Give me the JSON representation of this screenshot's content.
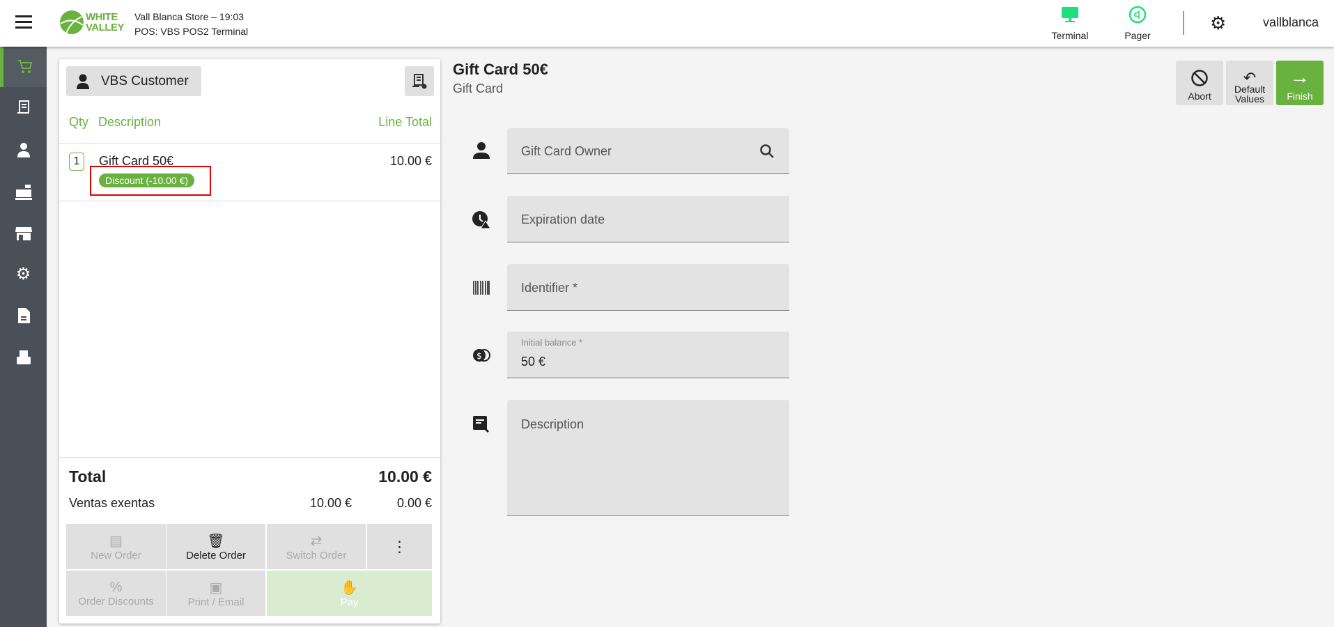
{
  "header": {
    "store": "Vall Blanca Store – 19:03",
    "pos": "POS: VBS POS2 Terminal",
    "logo_text": "WHITE VALLEY",
    "terminal": "Terminal",
    "pager": "Pager",
    "user": "vallblanca"
  },
  "order": {
    "customer": "VBS Customer",
    "col_qty": "Qty",
    "col_desc": "Description",
    "col_total": "Line Total",
    "lines": [
      {
        "qty": "1",
        "name": "Gift Card 50€",
        "total": "10.00 €",
        "badge": "Discount (-10.00 €)"
      }
    ],
    "total_label": "Total",
    "total_value": "10.00 €",
    "tax_label": "Ventas exentas",
    "tax_base": "10.00 €",
    "tax_amount": "0.00 €"
  },
  "actions": {
    "new_order": "New Order",
    "delete_order": "Delete Order",
    "switch_order": "Switch Order",
    "order_discounts": "Order Discounts",
    "print_email": "Print / Email",
    "pay": "Pay"
  },
  "form": {
    "title": "Gift Card 50€",
    "subtitle": "Gift Card",
    "abort": "Abort",
    "default_values": "Default Values",
    "finish": "Finish",
    "owner": "Gift Card Owner",
    "expiration": "Expiration date",
    "identifier": "Identifier *",
    "balance_label": "Initial balance *",
    "balance_value": "50 €",
    "description": "Description"
  },
  "colors": {
    "accent": "#6ab23f",
    "highlight": "#e00000"
  }
}
